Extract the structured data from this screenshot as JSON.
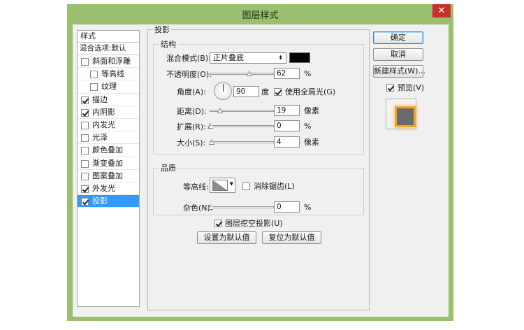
{
  "window": {
    "title": "图层样式",
    "close_glyph": "✕"
  },
  "styles": {
    "header": "样式",
    "blend_options": "混合选项:默认",
    "items": [
      {
        "label": "斜面和浮雕",
        "checked": false,
        "sub": false
      },
      {
        "label": "等高线",
        "checked": false,
        "sub": true
      },
      {
        "label": "纹理",
        "checked": false,
        "sub": true
      },
      {
        "label": "描边",
        "checked": true,
        "sub": false
      },
      {
        "label": "内阴影",
        "checked": true,
        "sub": false
      },
      {
        "label": "内发光",
        "checked": false,
        "sub": false
      },
      {
        "label": "光泽",
        "checked": false,
        "sub": false
      },
      {
        "label": "颜色叠加",
        "checked": false,
        "sub": false
      },
      {
        "label": "渐变叠加",
        "checked": false,
        "sub": false
      },
      {
        "label": "图案叠加",
        "checked": false,
        "sub": false
      },
      {
        "label": "外发光",
        "checked": true,
        "sub": false
      },
      {
        "label": "投影",
        "checked": true,
        "sub": false,
        "selected": true
      }
    ]
  },
  "panel": {
    "title": "投影",
    "structure": {
      "title": "结构",
      "blend_mode_label": "混合模式(B):",
      "blend_mode_value": "正片叠底",
      "shadow_color": "#050505",
      "opacity_label": "不透明度(O):",
      "opacity_value": "62",
      "opacity_unit": "%",
      "opacity_fraction": 0.62,
      "angle_label": "角度(A):",
      "angle_value": "90",
      "angle_unit": "度",
      "global_light_label": "使用全局光(G)",
      "global_light_checked": true,
      "distance_label": "距离(D):",
      "distance_value": "19",
      "distance_unit": "像素",
      "distance_fraction": 0.15,
      "spread_label": "扩展(R):",
      "spread_value": "0",
      "spread_unit": "%",
      "spread_fraction": 0.0,
      "size_label": "大小(S):",
      "size_value": "4",
      "size_unit": "像素",
      "size_fraction": 0.02
    },
    "quality": {
      "title": "品质",
      "contour_label": "等高线:",
      "antialias_label": "消除锯齿(L)",
      "antialias_checked": false,
      "noise_label": "杂色(N):",
      "noise_value": "0",
      "noise_unit": "%",
      "noise_fraction": 0.0
    },
    "knockout_label": "图层挖空投影(U)",
    "knockout_checked": true,
    "set_default_label": "设置为默认值",
    "reset_default_label": "复位为默认值"
  },
  "actions": {
    "ok": "确定",
    "cancel": "取消",
    "new_style": "新建样式(W)...",
    "preview_label": "预览(V)",
    "preview_checked": true
  }
}
